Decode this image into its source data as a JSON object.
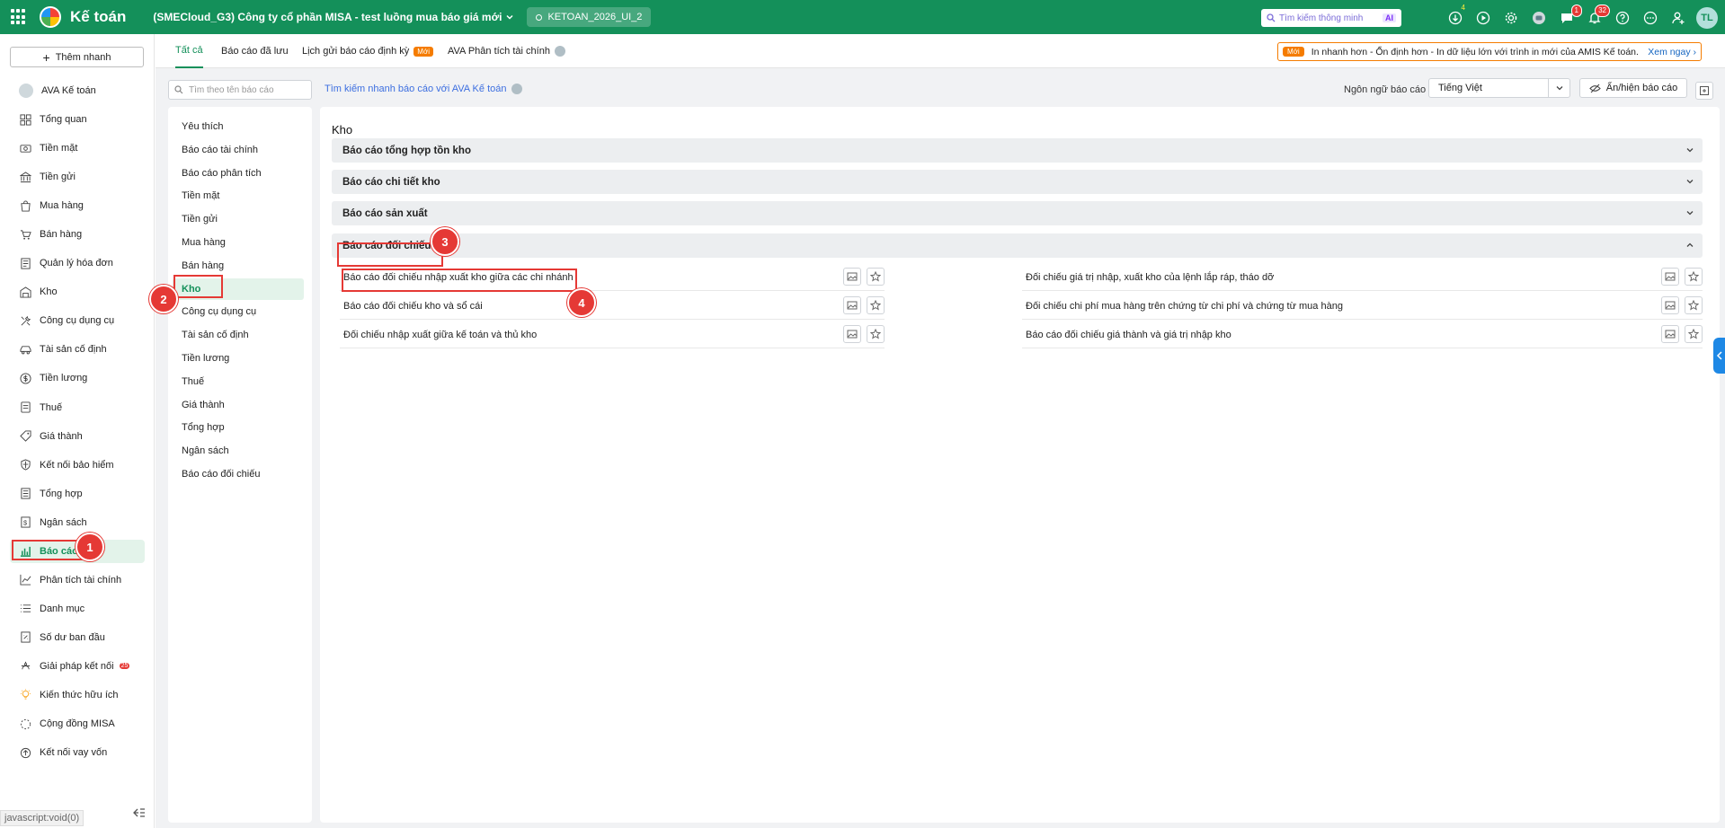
{
  "header": {
    "app_name": "Kế toán",
    "company": "(SMECloud_G3) Công ty cổ phần MISA - test luồng mua báo giá mới",
    "database": "KETOAN_2026_UI_2",
    "search_placeholder": "Tìm kiếm thông minh",
    "ai_label": "AI",
    "download_badge": "4",
    "chat_badge": "1",
    "notification_badge": "32",
    "user_initials": "TL"
  },
  "sidebar": {
    "add_button": "Thêm nhanh",
    "items": [
      {
        "label": "AVA Kế toán",
        "icon": "ava-robot-icon"
      },
      {
        "label": "Tổng quan",
        "icon": "dashboard-icon"
      },
      {
        "label": "Tiền mặt",
        "icon": "cash-icon"
      },
      {
        "label": "Tiền gửi",
        "icon": "bank-icon"
      },
      {
        "label": "Mua hàng",
        "icon": "shopping-bag-icon"
      },
      {
        "label": "Bán hàng",
        "icon": "cart-icon"
      },
      {
        "label": "Quản lý hóa đơn",
        "icon": "invoice-icon"
      },
      {
        "label": "Kho",
        "icon": "warehouse-icon"
      },
      {
        "label": "Công cụ dụng cụ",
        "icon": "tools-icon"
      },
      {
        "label": "Tài sản cố định",
        "icon": "car-icon"
      },
      {
        "label": "Tiền lương",
        "icon": "salary-icon"
      },
      {
        "label": "Thuế",
        "icon": "tax-icon"
      },
      {
        "label": "Giá thành",
        "icon": "price-tag-icon"
      },
      {
        "label": "Kết nối bảo hiểm",
        "icon": "shield-icon"
      },
      {
        "label": "Tổng hợp",
        "icon": "summary-icon"
      },
      {
        "label": "Ngân sách",
        "icon": "budget-icon"
      },
      {
        "label": "Báo cáo",
        "icon": "bar-chart-icon"
      },
      {
        "label": "Phân tích tài chính",
        "icon": "analytics-icon"
      },
      {
        "label": "Danh mục",
        "icon": "list-icon"
      },
      {
        "label": "Số dư ban đầu",
        "icon": "balance-icon"
      },
      {
        "label": "Giải pháp kết nối",
        "icon": "connect-icon",
        "badge": "25"
      },
      {
        "label": "Kiến thức hữu ích",
        "icon": "bulb-icon"
      },
      {
        "label": "Cộng đồng MISA",
        "icon": "community-icon"
      },
      {
        "label": "Kết nối vay vốn",
        "icon": "loan-icon"
      }
    ],
    "status_url": "javascript:void(0)"
  },
  "tabs": {
    "items": [
      "Tất cả",
      "Báo cáo đã lưu",
      "Lịch gửi báo cáo định kỳ",
      "AVA Phân tích tài chính"
    ],
    "new_tag": "Mới"
  },
  "promo": {
    "tag": "Mới",
    "text": "In nhanh hơn - Ổn định hơn - In dữ liệu lớn với trình in mới của AMIS Kế toán.",
    "link": "Xem ngay"
  },
  "toolbar": {
    "search_placeholder": "Tìm theo tên báo cáo",
    "ava_search": "Tìm kiếm nhanh báo cáo với AVA Kế toán",
    "lang_label": "Ngôn ngữ báo cáo",
    "lang_value": "Tiếng Việt",
    "toggle_label": "Ẩn/hiện báo cáo"
  },
  "categories": [
    "Yêu thích",
    "Báo cáo tài chính",
    "Báo cáo phân tích",
    "Tiền mặt",
    "Tiền gửi",
    "Mua hàng",
    "Bán hàng",
    "Kho",
    "Công cụ dụng cụ",
    "Tài sản cố định",
    "Tiền lương",
    "Thuế",
    "Giá thành",
    "Tổng hợp",
    "Ngân sách",
    "Báo cáo đối chiếu"
  ],
  "content": {
    "section_title": "Kho",
    "groups": [
      "Báo cáo tổng hợp tồn kho",
      "Báo cáo chi tiết kho",
      "Báo cáo sản xuất",
      "Báo cáo đối chiếu"
    ],
    "reports_left": [
      "Báo cáo đối chiếu nhập xuất kho giữa các chi nhánh",
      "Báo cáo đối chiếu kho và sổ cái",
      "Đối chiếu nhập xuất giữa kế toán và thủ kho"
    ],
    "reports_right": [
      "Đối chiếu giá trị nhập, xuất kho của lệnh lắp ráp, tháo dỡ",
      "Đối chiếu chi phí mua hàng trên chứng từ chi phí và chứng từ mua hàng",
      "Báo cáo đối chiếu giá thành và giá trị nhập kho"
    ]
  },
  "steps": [
    "1",
    "2",
    "3",
    "4"
  ],
  "colors": {
    "brand": "#14905a",
    "accent_red": "#e53935",
    "promo_orange": "#f57c00"
  }
}
